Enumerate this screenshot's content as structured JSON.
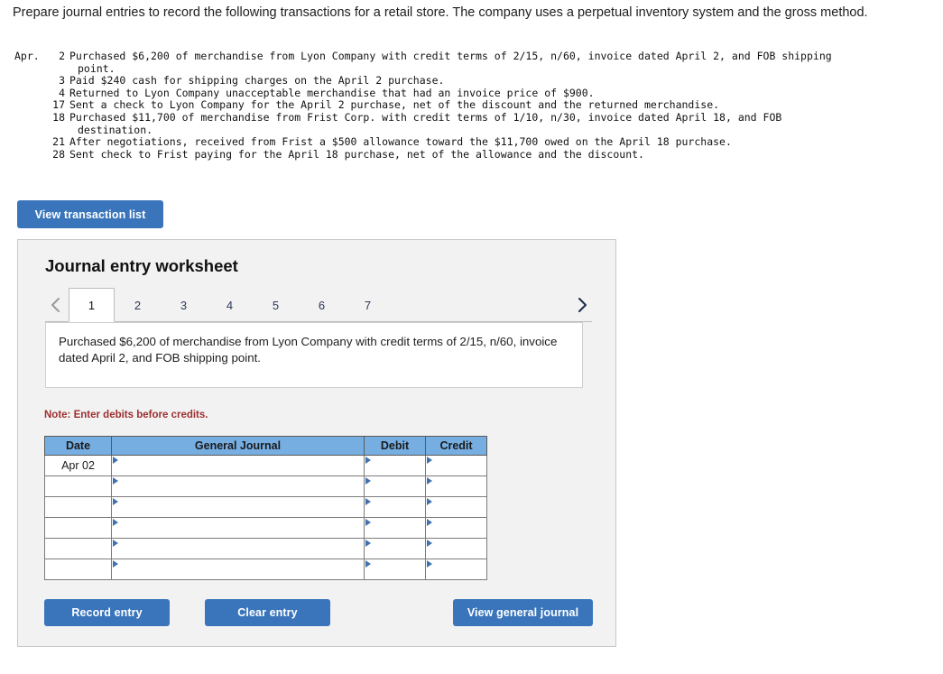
{
  "intro": {
    "text": "Prepare journal entries to record the following transactions for a retail store. The company uses a perpetual inventory system and the gross method."
  },
  "transactions": {
    "month_label": "Apr.",
    "rows": [
      {
        "day": "2",
        "text": "Purchased $6,200 of merchandise from Lyon Company with credit terms of 2/15, n/60, invoice dated April 2, and FOB shipping",
        "cont": "point."
      },
      {
        "day": "3",
        "text": "Paid $240 cash for shipping charges on the April 2 purchase.",
        "cont": ""
      },
      {
        "day": "4",
        "text": "Returned to Lyon Company unacceptable merchandise that had an invoice price of $900.",
        "cont": ""
      },
      {
        "day": "17",
        "text": "Sent a check to Lyon Company for the April 2 purchase, net of the discount and the returned merchandise.",
        "cont": ""
      },
      {
        "day": "18",
        "text": "Purchased $11,700 of merchandise from Frist Corp. with credit terms of 1/10, n/30, invoice dated April 18, and FOB",
        "cont": "destination."
      },
      {
        "day": "21",
        "text": "After negotiations, received from Frist a $500 allowance toward the $11,700 owed on the April 18 purchase.",
        "cont": ""
      },
      {
        "day": "28",
        "text": "Sent check to Frist paying for the April 18 purchase, net of the allowance and the discount.",
        "cont": ""
      }
    ]
  },
  "view_transaction_list_button": {
    "label": "View transaction list"
  },
  "worksheet": {
    "title": "Journal entry worksheet",
    "tabs": [
      {
        "label": "1",
        "active": true
      },
      {
        "label": "2",
        "active": false
      },
      {
        "label": "3",
        "active": false
      },
      {
        "label": "4",
        "active": false
      },
      {
        "label": "5",
        "active": false
      },
      {
        "label": "6",
        "active": false
      },
      {
        "label": "7",
        "active": false
      }
    ],
    "prev_arrow": "chevron-left",
    "next_arrow": "chevron-right",
    "description": "Purchased $6,200 of merchandise from Lyon Company with credit terms of 2/15, n/60, invoice dated April 2, and FOB shipping point.",
    "note": "Note: Enter debits before credits.",
    "table": {
      "headers": [
        "Date",
        "General Journal",
        "Debit",
        "Credit"
      ],
      "rows": [
        {
          "date": "Apr 02",
          "general_journal": "",
          "debit": "",
          "credit": ""
        },
        {
          "date": "",
          "general_journal": "",
          "debit": "",
          "credit": ""
        },
        {
          "date": "",
          "general_journal": "",
          "debit": "",
          "credit": ""
        },
        {
          "date": "",
          "general_journal": "",
          "debit": "",
          "credit": ""
        },
        {
          "date": "",
          "general_journal": "",
          "debit": "",
          "credit": ""
        },
        {
          "date": "",
          "general_journal": "",
          "debit": "",
          "credit": ""
        }
      ]
    },
    "buttons": {
      "record": "Record entry",
      "clear": "Clear entry",
      "view_general_journal": "View general journal"
    }
  },
  "colors": {
    "button_blue": "#3a75bb",
    "header_blue": "#77aee2",
    "cell_border_blue": "#4a7cb5",
    "note_red": "#9d2f2f",
    "panel_gray": "#f2f2f2"
  }
}
